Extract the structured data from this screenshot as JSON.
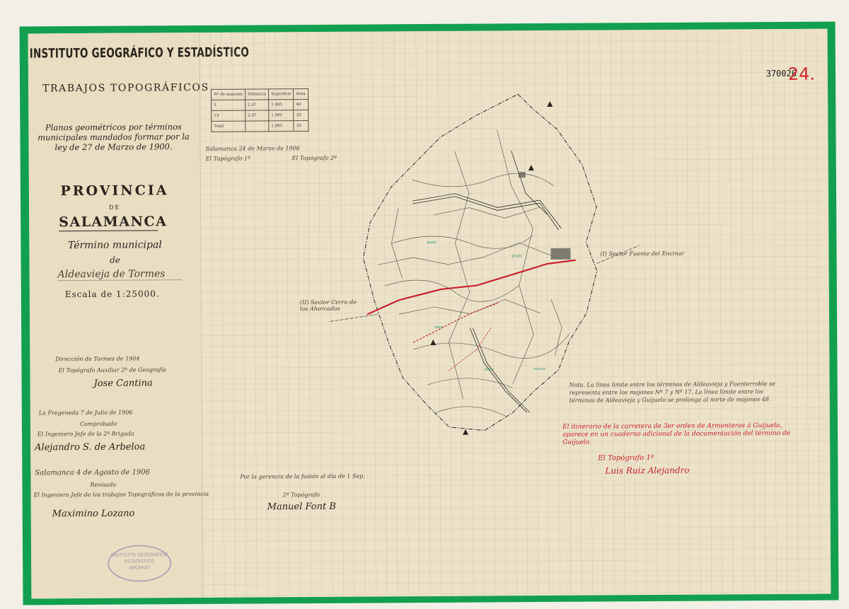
{
  "header": {
    "institute": "INSTITUTO GEOGRÁFICO Y ESTADÍSTICO",
    "subtitle": "TRABAJOS TOPOGRÁFICOS",
    "description": "Planos geométricos por términos municipales mandados formar por la ley de 27 de Marzo de 1900.",
    "province_label": "PROVINCIA",
    "de": "DE",
    "province": "SALAMANCA",
    "term_label": "Término municipal",
    "de2": "de",
    "municipality": "Aldeavieja de Tormes",
    "scale": "Escala de 1:25000."
  },
  "sheet": {
    "code": "370026",
    "number": "24."
  },
  "margin_notes": {
    "n1": "Dirección de Tormes de 1904",
    "n2": "El Topógrafo Auxiliar 2º de Geografía",
    "sig1": "Jose Cantina",
    "n3": "La Fregeneda 7 de Julio de 1906",
    "n4": "Comprobado",
    "n5": "El Ingeniero Jefe de la 2ª Brigada",
    "sig2": "Alejandro S. de Arbeloa",
    "n6": "Salamanca 4 de Agosto de 1906",
    "n7": "Revisado",
    "n8": "El Ingeniero Jefe de los trabajos Topográficos de la provincia",
    "sig3": "Maximino Lozano"
  },
  "map_notes": {
    "red_note": "El itinerario de la carretera de 3er orden de Armenteros á Guijuelo, aparece en un cuaderno adicional de la documentación del término de Guijuelo.",
    "red_sign_label": "El Topógrafo 1º",
    "red_sig": "Luis Ruiz Alejandro",
    "black_note": "Nota. La línea limite entre los términos de Aldeavieja y Fuenterroble se representa entre los mojones Nº 7 y Nº 17. La línea límite entre los términos de Aldeavieja y Guijuelo se prolonga al norte de mojones 48",
    "pencil_note": "Por la gerencia de la fusión al día de 1 Sep.",
    "pencil_sign": "2º Topógrafo",
    "pencil_sig": "Manuel Font B",
    "top_note": "Salamanca 24 de Marzo de 1906",
    "top_note2": "El Topógrafo 1º",
    "top_note3": "El Topógrafo 2º",
    "right_label": "(I) Sector Fuente del Encinar",
    "left_label": "(II) Sector Cerro de los Ahorcados"
  },
  "table": {
    "rows": [
      [
        "Nº de mojones",
        "Distancia",
        "Superficie",
        "Area"
      ],
      [
        "5",
        "2.47",
        "1.885",
        "40"
      ],
      [
        "13",
        "2.47",
        "1.995",
        "20"
      ],
      [
        "Total",
        "",
        "1.885",
        "20"
      ]
    ]
  },
  "stamp": {
    "l1": "INSTITUTO GEOGRÁFICO",
    "l2": "ESTADÍSTICO",
    "l3": "ARCHIVO"
  },
  "colors": {
    "border": "#12a050",
    "paper": "#ece2c8",
    "grid": "#b8b6ae",
    "ink": "#2a241c",
    "red": "#c8202a"
  }
}
